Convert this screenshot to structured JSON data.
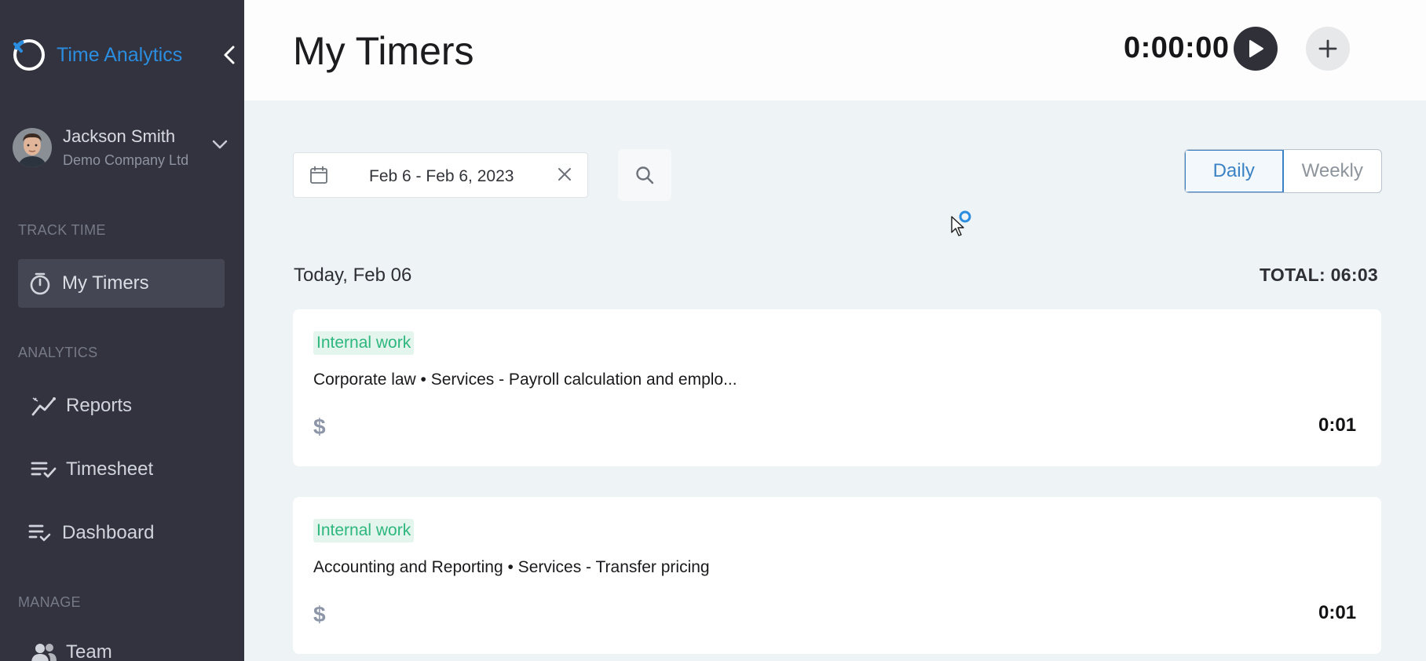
{
  "app": {
    "name": "Time Analytics"
  },
  "user": {
    "name": "Jackson Smith",
    "company": "Demo Company Ltd"
  },
  "sidebar": {
    "sections": [
      {
        "label": "TRACK TIME"
      },
      {
        "label": "ANALYTICS"
      },
      {
        "label": "MANAGE"
      }
    ],
    "items": [
      {
        "label": "My Timers",
        "icon": "stopwatch-icon",
        "active": true
      },
      {
        "label": "Reports",
        "icon": "trend-chart-icon"
      },
      {
        "label": "Timesheet",
        "icon": "checklist-icon"
      },
      {
        "label": "Dashboard",
        "icon": "list-check-icon"
      },
      {
        "label": "Team",
        "icon": "team-icon"
      }
    ]
  },
  "header": {
    "title": "My Timers",
    "timer": "0:00:00"
  },
  "toolbar": {
    "date_range": "Feb 6 - Feb 6, 2023",
    "view_options": [
      "Daily",
      "Weekly"
    ],
    "selected_view": "Daily"
  },
  "day": {
    "label": "Today, Feb 06",
    "total": "TOTAL: 06:03"
  },
  "entries": [
    {
      "tag": "Internal work",
      "description": "Corporate law • Services - Payroll calculation and emplo...",
      "billable_symbol": "$",
      "duration": "0:01"
    },
    {
      "tag": "Internal work",
      "description": "Accounting and Reporting • Services - Transfer pricing",
      "billable_symbol": "$",
      "duration": "0:01"
    }
  ],
  "colors": {
    "sidebar_bg": "#32333f",
    "brand": "#2b8de0",
    "tag_text": "#2db77e",
    "tag_bg": "#e3f5ec",
    "accent": "#3a82c4"
  }
}
